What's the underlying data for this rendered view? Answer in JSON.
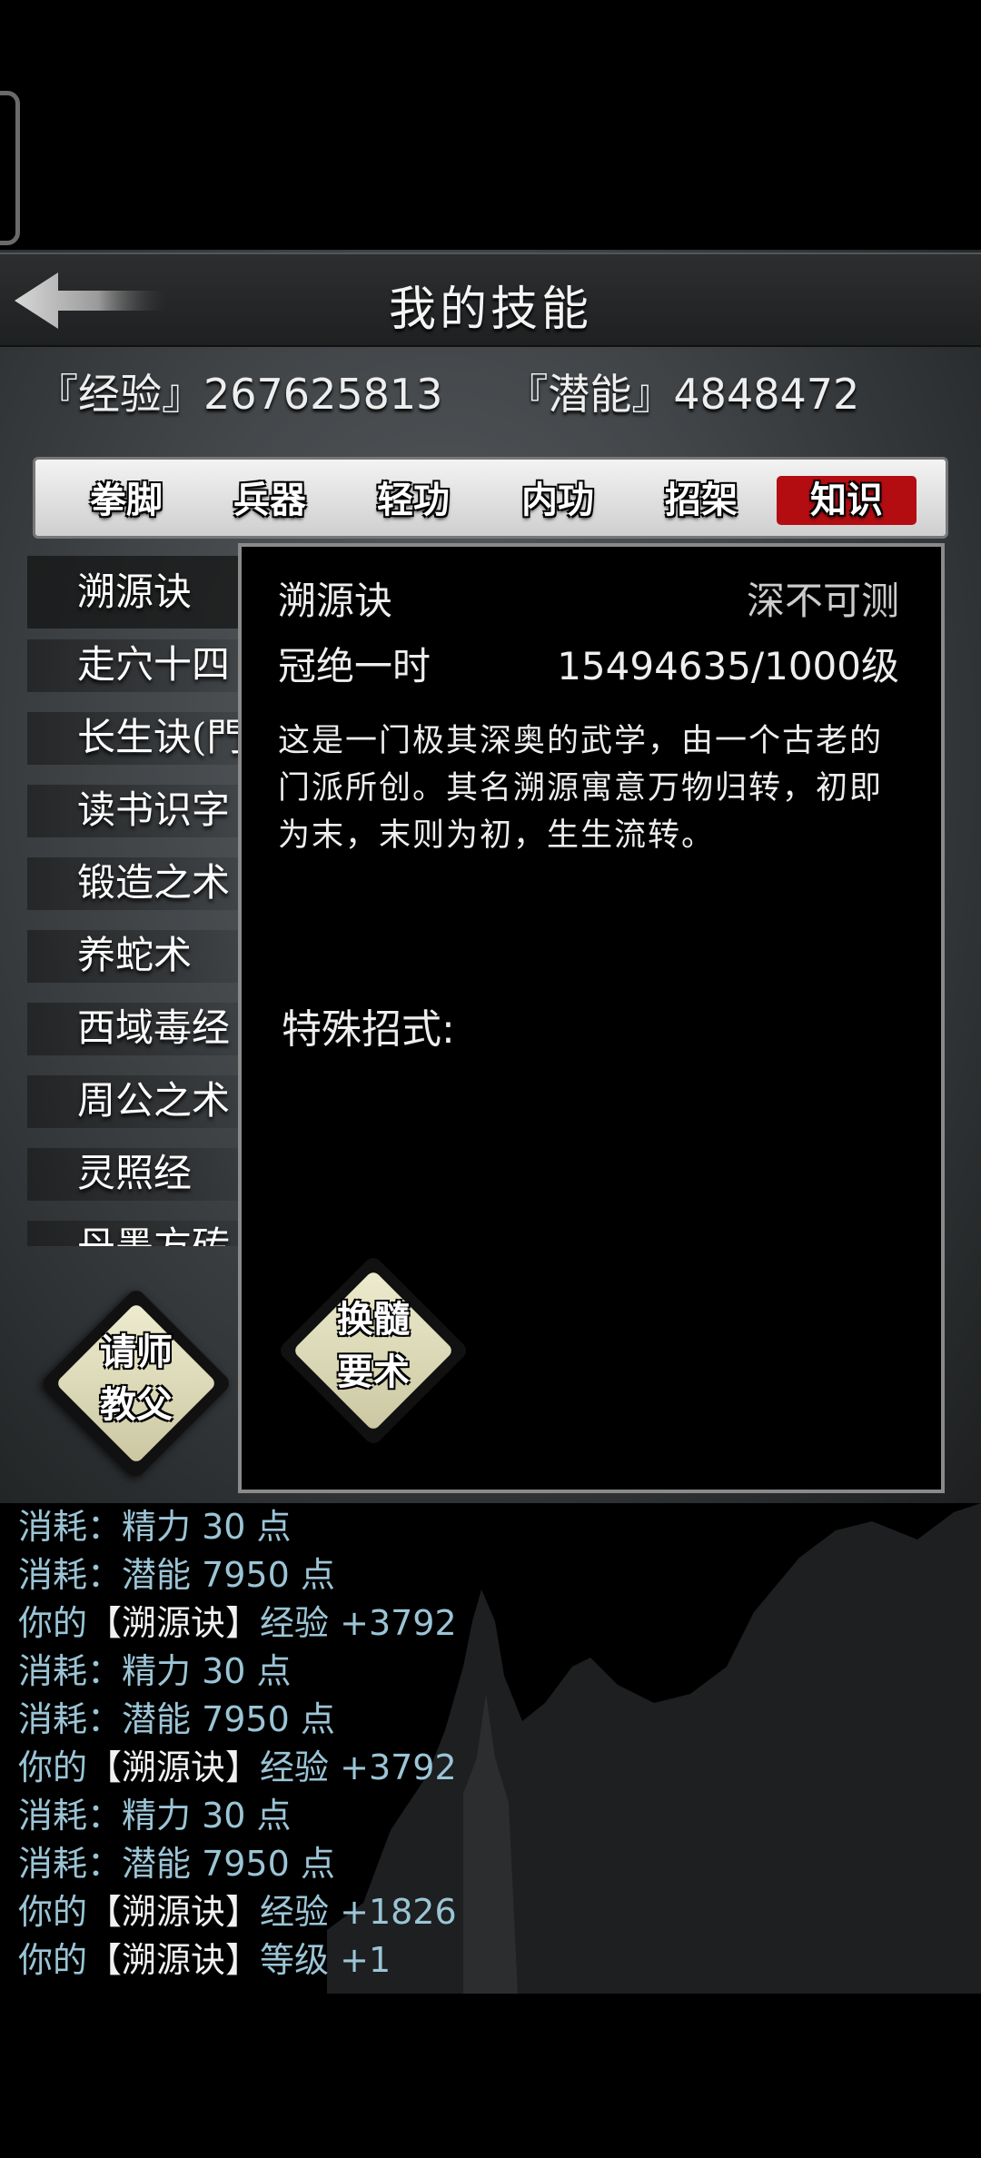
{
  "header": {
    "title": "我的技能"
  },
  "stats": {
    "exp_label": "『经验』",
    "exp_value": "267625813",
    "pot_label": "『潜能』",
    "pot_value": "4848472"
  },
  "tabs": [
    {
      "label": "拳脚"
    },
    {
      "label": "兵器"
    },
    {
      "label": "轻功"
    },
    {
      "label": "内功"
    },
    {
      "label": "招架"
    },
    {
      "label": "知识"
    }
  ],
  "active_tab": "知识",
  "accent_color": "#b30d12",
  "skill_list": [
    {
      "label": "溯源诀"
    },
    {
      "label": "走穴十四"
    },
    {
      "label": "长生诀(門"
    },
    {
      "label": "读书识字"
    },
    {
      "label": "锻造之术"
    },
    {
      "label": "养蛇术"
    },
    {
      "label": "西域毒经"
    },
    {
      "label": "周公之术"
    },
    {
      "label": "灵照经"
    },
    {
      "label": "丹墨方砖"
    }
  ],
  "buttons": {
    "teacher_line1": "请师",
    "teacher_line2": "教父",
    "marrow_line1": "换髓",
    "marrow_line2": "要术"
  },
  "detail": {
    "name": "溯源诀",
    "rank": "深不可测",
    "title": "冠绝一时",
    "level": "15494635/1000级",
    "description": "这是一门极其深奥的武学，由一个古老的门派所创。其名溯源寓意万物归转，初即为末，末则为初，生生流转。",
    "special_label": "特殊招式:"
  },
  "log": [
    {
      "pre": "消耗：精力 30 点",
      "hl": "",
      "post": ""
    },
    {
      "pre": "消耗：潜能 7950 点",
      "hl": "",
      "post": ""
    },
    {
      "pre": "你的",
      "hl": "【溯源诀】",
      "post": "经验 +3792"
    },
    {
      "pre": "消耗：精力 30 点",
      "hl": "",
      "post": ""
    },
    {
      "pre": "消耗：潜能 7950 点",
      "hl": "",
      "post": ""
    },
    {
      "pre": "你的",
      "hl": "【溯源诀】",
      "post": "经验 +3792"
    },
    {
      "pre": "消耗：精力 30 点",
      "hl": "",
      "post": ""
    },
    {
      "pre": "消耗：潜能 7950 点",
      "hl": "",
      "post": ""
    },
    {
      "pre": "你的",
      "hl": "【溯源诀】",
      "post": "经验 +1826"
    },
    {
      "pre": "你的",
      "hl": "【溯源诀】",
      "post": "等级 +1"
    }
  ]
}
